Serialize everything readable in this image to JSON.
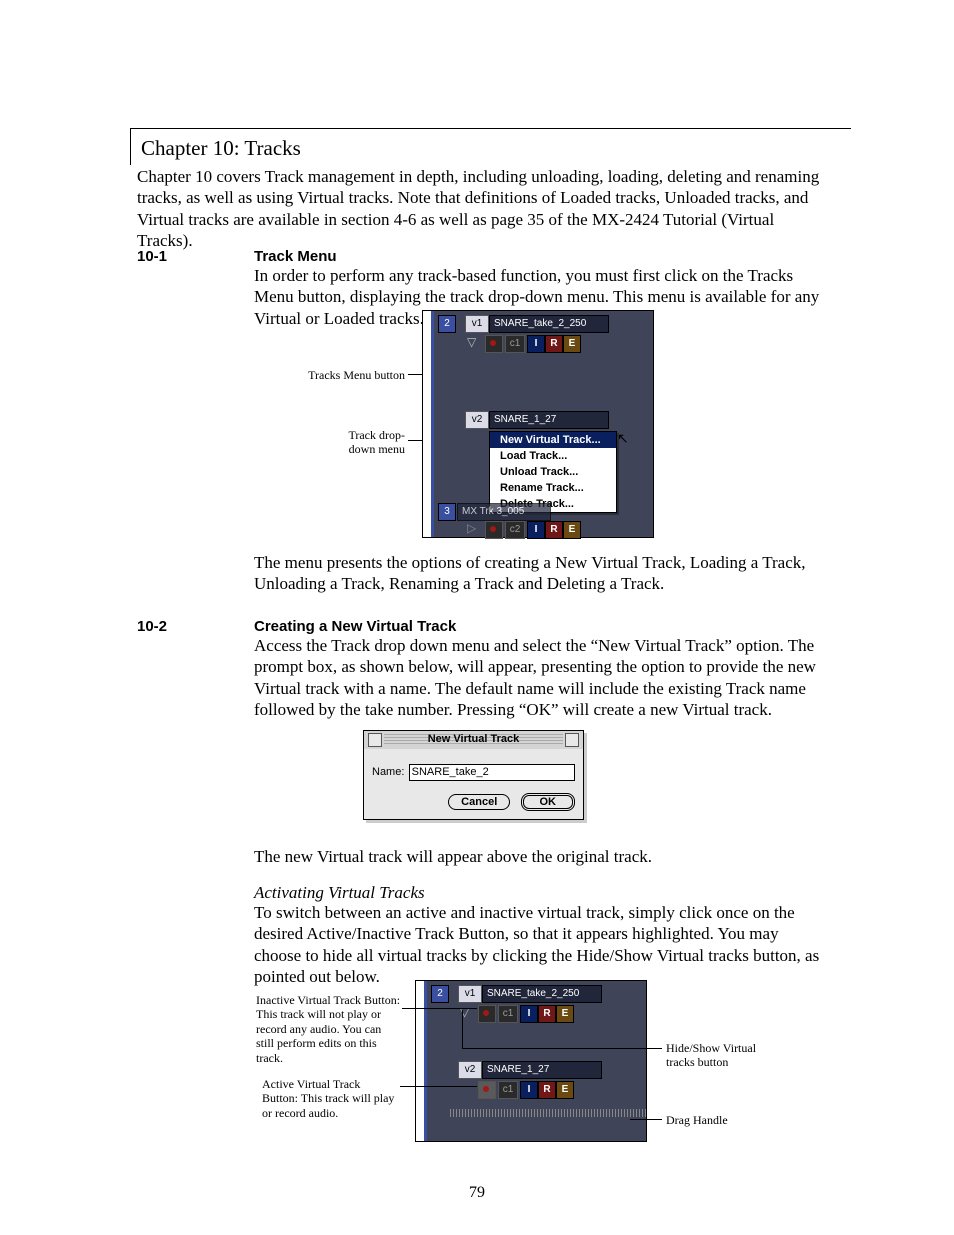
{
  "chapter": "Chapter 10: Tracks",
  "intro": "Chapter 10 covers Track management in depth, including unloading, loading, deleting and renaming tracks, as well as using Virtual tracks. Note that definitions of Loaded tracks, Unloaded tracks, and Virtual tracks are available in section 4-6 as well as page 35 of the MX-2424 Tutorial (Virtual Tracks).",
  "s1": {
    "num": "10-1",
    "title": "Track Menu",
    "p1": "In order to perform any track-based function, you must first click on the Tracks Menu button, displaying the track drop-down menu. This menu is available for any Virtual or Loaded tracks.",
    "p2": "The menu presents the options of creating a New Virtual Track, Loading a Track, Unloading a Track, Renaming a Track and Deleting a Track."
  },
  "s2": {
    "num": "10-2",
    "title": "Creating a New Virtual Track",
    "p1": "Access the Track drop down menu and select the “New Virtual Track” option. The prompt box, as shown below, will appear, presenting the option to provide the new Virtual track with a name. The default name will include the existing Track name followed by the take number. Pressing “OK” will create a new Virtual track.",
    "p2": "The new Virtual track will appear above the original track."
  },
  "act": {
    "title": "Activating Virtual Tracks",
    "p": "To switch between an active and inactive virtual track, simply click once on the desired Active/Inactive Track Button, so that it appears highlighted. You may choose to hide all virtual tracks by clicking the Hide/Show Virtual tracks button, as pointed out below."
  },
  "fig1": {
    "trk2": "2",
    "v1": "v1",
    "name1": "SNARE_take_2_250",
    "c1": "c1",
    "I": "I",
    "R": "R",
    "E": "E",
    "v2": "v2",
    "name2": "SNARE_1_27",
    "trk3": "3",
    "name3": "MX Trk 3_005",
    "c2": "c2",
    "menu": [
      "New Virtual Track...",
      "Load Track...",
      "Unload Track...",
      "Rename Track...",
      "Delete Track..."
    ]
  },
  "fig1labels": {
    "a": "Tracks Menu button",
    "b1": "Track drop-",
    "b2": "down menu"
  },
  "dlg": {
    "title": "New Virtual Track",
    "nameLbl": "Name:",
    "nameVal": "SNARE_take_2",
    "cancel": "Cancel",
    "ok": "OK"
  },
  "fig3labels": {
    "inact": "Inactive Virtual Track Button:  This track will not play or record any audio. You can still perform edits on this track.",
    "act": "Active Virtual Track Button: This track will play or record audio.",
    "hide": "Hide/Show Virtual tracks button",
    "drag": "Drag Handle"
  },
  "page": "79"
}
